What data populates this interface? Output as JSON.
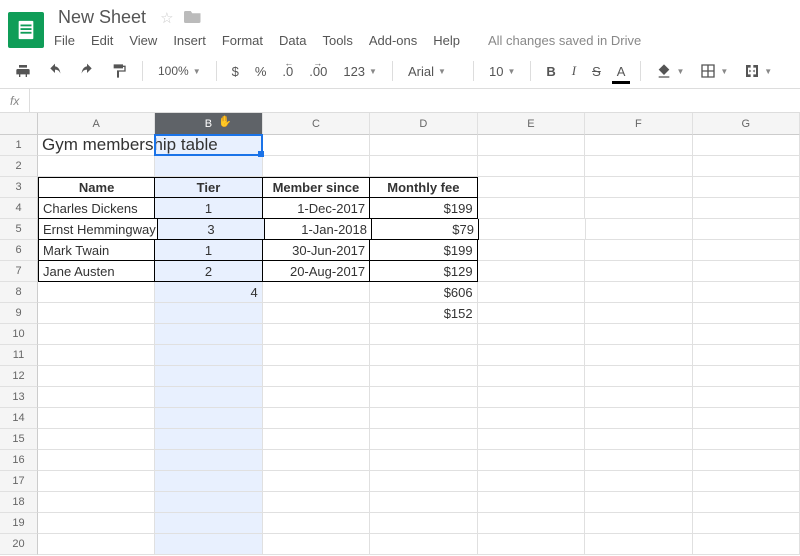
{
  "doc": {
    "title": "New Sheet",
    "save_status": "All changes saved in Drive"
  },
  "menus": {
    "file": "File",
    "edit": "Edit",
    "view": "View",
    "insert": "Insert",
    "format": "Format",
    "data": "Data",
    "tools": "Tools",
    "addons": "Add-ons",
    "help": "Help"
  },
  "toolbar": {
    "zoom": "100%",
    "currency": "$",
    "percent": "%",
    "dec_dec": ".0",
    "dec_inc": ".00",
    "more_formats": "123",
    "font_name": "Arial",
    "font_size": "10",
    "bold": "B",
    "italic": "I",
    "strike": "S",
    "text_color": "A"
  },
  "formula_bar": {
    "fx": "fx",
    "value": ""
  },
  "columns": [
    "A",
    "B",
    "C",
    "D",
    "E",
    "F",
    "G"
  ],
  "rows": [
    "1",
    "2",
    "3",
    "4",
    "5",
    "6",
    "7",
    "8",
    "9",
    "10",
    "11",
    "12",
    "13",
    "14",
    "15",
    "16",
    "17",
    "18",
    "19",
    "20"
  ],
  "selected_column_index": 1,
  "cells": {
    "title": "Gym membership table",
    "headers": {
      "name": "Name",
      "tier": "Tier",
      "since": "Member since",
      "fee": "Monthly fee"
    },
    "r4": {
      "name": "Charles Dickens",
      "tier": "1",
      "since": "1-Dec-2017",
      "fee": "$199"
    },
    "r5": {
      "name": "Ernst Hemmingway",
      "tier": "3",
      "since": "1-Jan-2018",
      "fee": "$79"
    },
    "r6": {
      "name": "Mark Twain",
      "tier": "1",
      "since": "30-Jun-2017",
      "fee": "$199"
    },
    "r7": {
      "name": "Jane Austen",
      "tier": "2",
      "since": "20-Aug-2017",
      "fee": "$129"
    },
    "r8": {
      "tier_count": "4",
      "fee_sum": "$606"
    },
    "r9": {
      "fee_avg": "$152"
    }
  },
  "chart_data": {
    "type": "table",
    "title": "Gym membership table",
    "columns": [
      "Name",
      "Tier",
      "Member since",
      "Monthly fee"
    ],
    "rows": [
      [
        "Charles Dickens",
        1,
        "1-Dec-2017",
        199
      ],
      [
        "Ernst Hemmingway",
        3,
        "1-Jan-2018",
        79
      ],
      [
        "Mark Twain",
        1,
        "30-Jun-2017",
        199
      ],
      [
        "Jane Austen",
        2,
        "20-Aug-2017",
        129
      ]
    ],
    "summary": {
      "count_tier": 4,
      "sum_fee": 606,
      "avg_fee": 152
    }
  }
}
